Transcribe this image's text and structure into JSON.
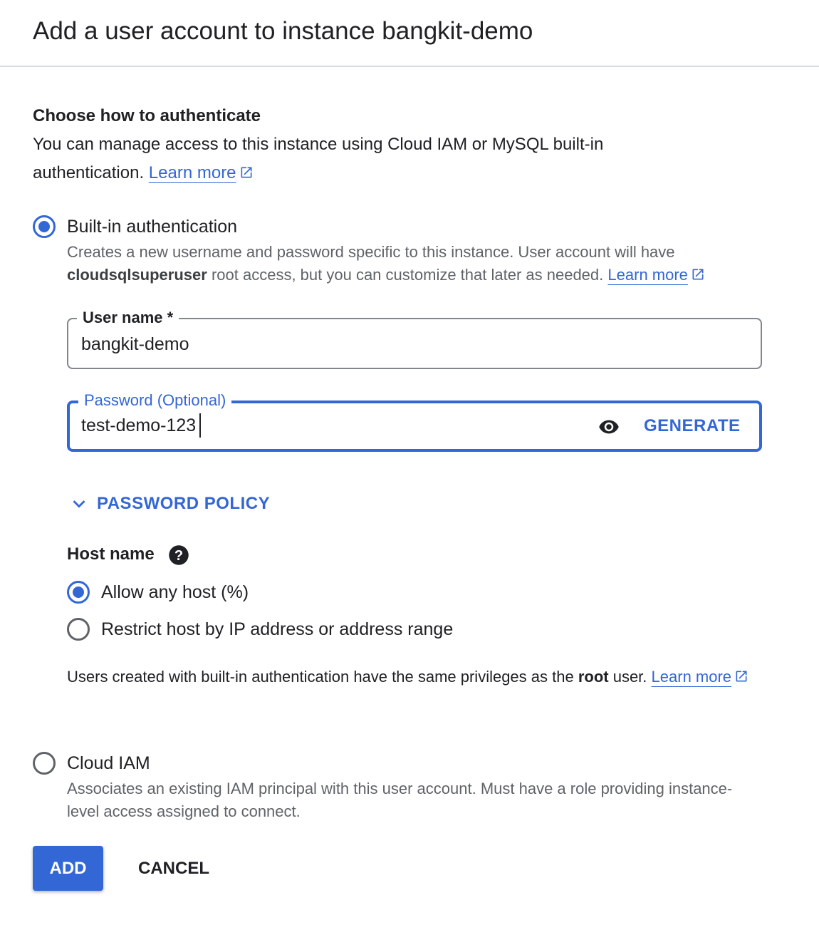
{
  "dialog": {
    "title": "Add a user account to instance bangkit-demo"
  },
  "auth_section": {
    "title": "Choose how to authenticate",
    "description": "You can manage access to this instance using Cloud IAM or MySQL built-in authentication.",
    "learn_more": "Learn more"
  },
  "builtin": {
    "label": "Built-in authentication",
    "selected": true,
    "desc_part1": "Creates a new username and password specific to this instance. User account will have ",
    "desc_bold": "cloudsqlsuperuser",
    "desc_part2": " root access, but you can customize that later as needed.",
    "learn_more": "Learn more"
  },
  "username_field": {
    "label": "User name *",
    "value": "bangkit-demo"
  },
  "password_field": {
    "label": "Password (Optional)",
    "value": "test-demo-123",
    "generate_label": "GENERATE"
  },
  "password_policy": {
    "label": "PASSWORD POLICY"
  },
  "host": {
    "title": "Host name",
    "options": [
      {
        "label": "Allow any host (%)",
        "selected": true
      },
      {
        "label": "Restrict host by IP address or address range",
        "selected": false
      }
    ]
  },
  "note": {
    "part1": "Users created with built-in authentication have the same privileges as the ",
    "bold": "root",
    "part2": " user.",
    "learn_more": "Learn more"
  },
  "cloud_iam": {
    "label": "Cloud IAM",
    "selected": false,
    "description": "Associates an existing IAM principal with this user account. Must have a role providing instance-level access assigned to connect."
  },
  "actions": {
    "add_label": "ADD",
    "cancel_label": "CANCEL"
  },
  "colors": {
    "accent": "#3367d6",
    "divider": "#dadce0",
    "secondary_text": "#5f6368"
  }
}
